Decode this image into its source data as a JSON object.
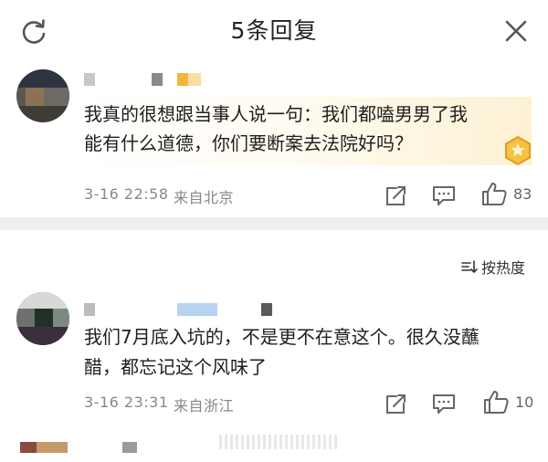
{
  "header": {
    "title": "5条回复"
  },
  "comments": [
    {
      "text_line1": "我真的很想跟当事人说一句：我们都嗑男男了我",
      "text_line2": "能有什么道德，你们要断案去法院好吗？",
      "timestamp": "3-16 22:58",
      "location": "来自北京",
      "like_count": "83"
    },
    {
      "text_line1": "我们7月底入坑的，不是更不在意这个。很久没蘸",
      "text_line2": "醋，都忘记这个风味了",
      "timestamp": "3-16 23:31",
      "location": "来自浙江",
      "like_count": "10"
    }
  ],
  "sort": {
    "label": "按热度"
  },
  "icons": {
    "refresh": "refresh-icon",
    "close": "close-icon",
    "share": "share-icon",
    "comment": "comment-icon",
    "like": "thumbs-up-icon",
    "sort": "sort-icon",
    "badge": "gold-badge-icon"
  },
  "colors": {
    "background": "#ffffff",
    "divider": "#eeeeee",
    "meta_text": "#888888",
    "highlight": "#fdf1d4",
    "badge": "#f5b73a"
  }
}
